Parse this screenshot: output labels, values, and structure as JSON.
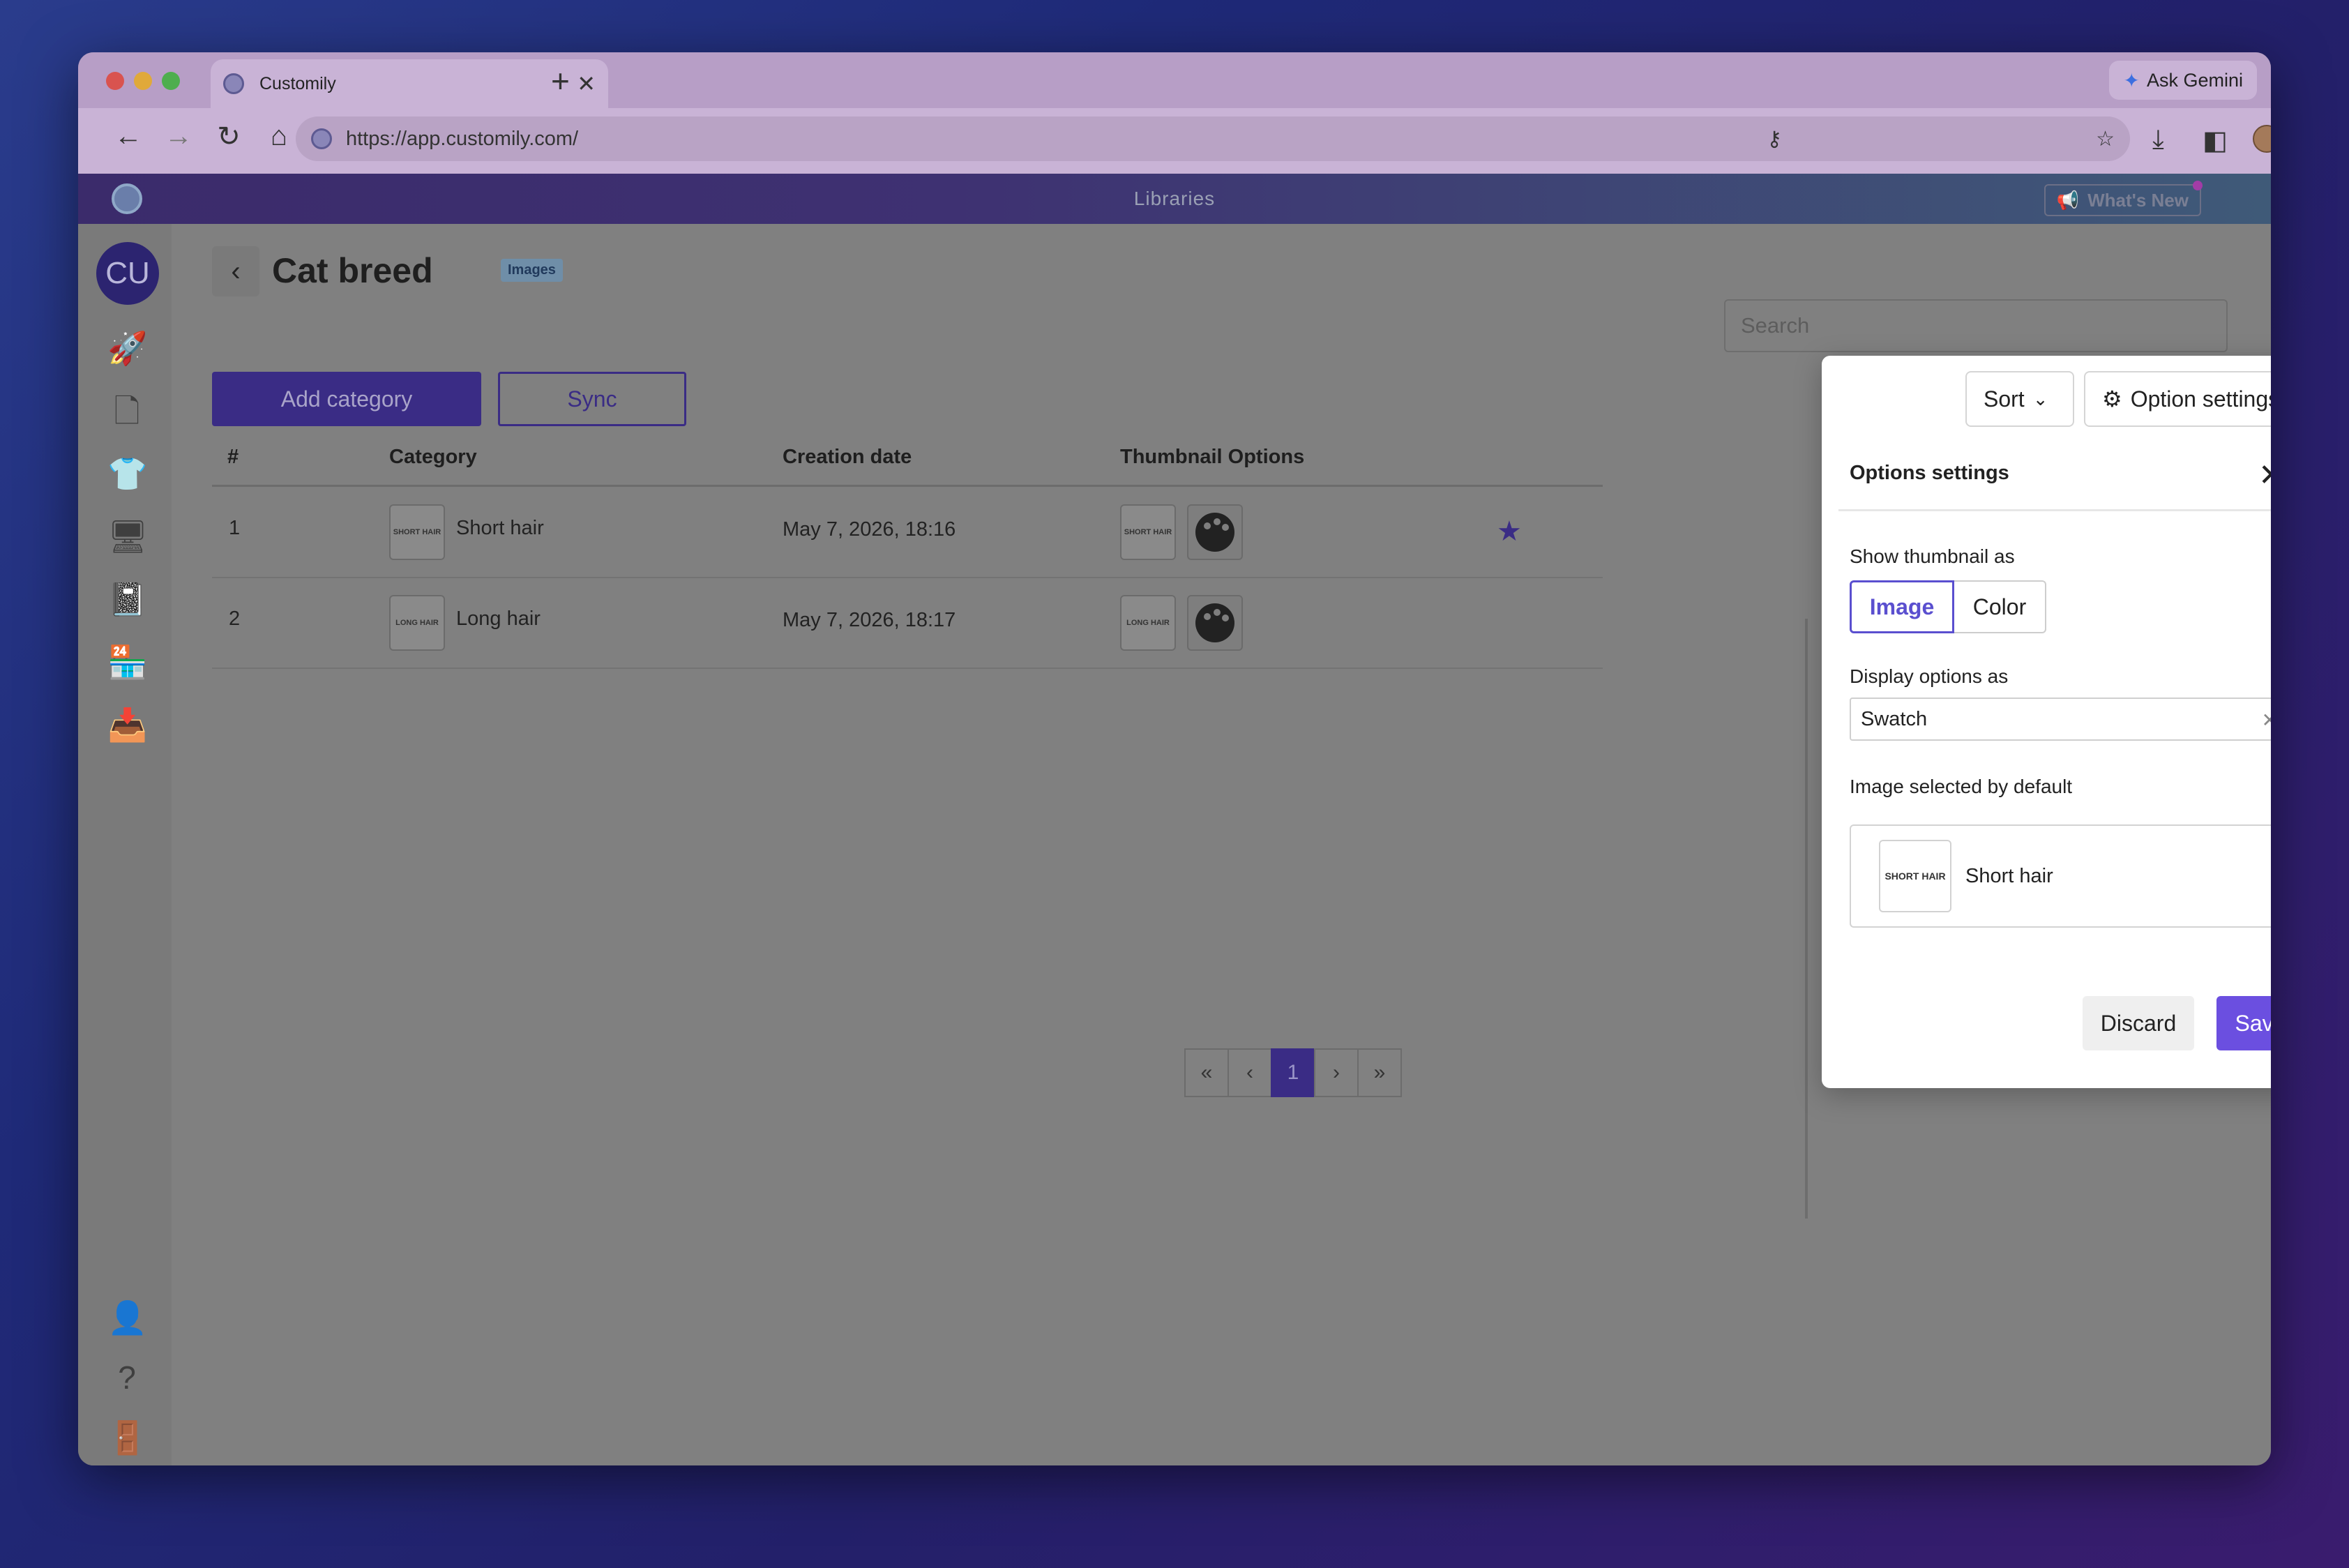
{
  "browser": {
    "tab_title": "Customily",
    "tab_close": "✕",
    "new_tab": "+",
    "gemini_label": "Ask Gemini",
    "url": "https://app.customily.com/"
  },
  "app": {
    "header_title": "Libraries",
    "whats_new": "What's New",
    "avatar_initials": "CU"
  },
  "page": {
    "title": "Cat breed",
    "badge": "Images",
    "add_category": "Add category",
    "sync": "Sync",
    "search_placeholder": "Search"
  },
  "table": {
    "headers": [
      "#",
      "Category",
      "Creation date",
      "Thumbnail Options"
    ],
    "rows": [
      {
        "num": "1",
        "thumb_text": "SHORT HAIR",
        "category": "Short hair",
        "date": "May 7, 2026, 18:16",
        "starred": true
      },
      {
        "num": "2",
        "thumb_text": "LONG HAIR",
        "category": "Long hair",
        "date": "May 7, 2026, 18:17",
        "starred": false
      }
    ]
  },
  "pagination": {
    "first": "«",
    "prev": "‹",
    "current": "1",
    "next": "›",
    "last": "»"
  },
  "panel": {
    "sort_label": "Sort",
    "option_settings_label": "Option settings",
    "title": "Options settings",
    "show_thumbnail_label": "Show thumbnail as",
    "thumb_image": "Image",
    "thumb_color": "Color",
    "display_options_label": "Display options as",
    "display_value": "Swatch",
    "image_default_label": "Image selected by default",
    "default_thumb_text": "SHORT HAIR",
    "default_name": "Short hair",
    "discard": "Discard",
    "save": "Save"
  },
  "colors": {
    "primary": "#5a4fcf",
    "save": "#6b4fe0",
    "star": "#3a2c85"
  }
}
